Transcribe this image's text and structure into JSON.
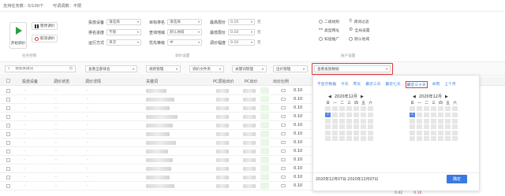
{
  "top_info": {
    "limit": "支持任务数：0/100个",
    "status": "可调调数：不限"
  },
  "task_control": {
    "start_label": "开始调价",
    "pause_label": "暂停调价",
    "cancel_label": "取消调价",
    "group_label": "任务控制"
  },
  "bid_settings": {
    "group_label": "调价设置",
    "fields": [
      {
        "label": "投放设备",
        "value": "请选择"
      },
      {
        "label": "排名进度",
        "value": "不限"
      },
      {
        "label": "运行方式",
        "value": "单次"
      },
      {
        "label": "目标排名",
        "value": "请选择"
      },
      {
        "label": "查询地域",
        "value": "默认地域"
      },
      {
        "label": "优先等级",
        "value": "中"
      },
      {
        "label": "最高限价",
        "value": "0.10"
      },
      {
        "label": "最低限价",
        "value": "0.10"
      },
      {
        "label": "调价幅度",
        "value": "0.10"
      }
    ],
    "unit": "元"
  },
  "account_settings": {
    "group_label": "账户设置",
    "options": [
      {
        "label": "二级规则",
        "icon": "radio-icon"
      },
      {
        "label": "调词过滤",
        "icon": "filter-icon"
      },
      {
        "label": "类型网址",
        "icon": "link-icon"
      },
      {
        "label": "全局设置",
        "icon": "gear-icon"
      },
      {
        "label": "知道推广",
        "icon": "radio-icon"
      },
      {
        "label": "默认地域",
        "icon": "radio-icon"
      }
    ]
  },
  "toolbar": {
    "search_placeholder": "搜索关键词",
    "selects": [
      "查看全部排名",
      "规则管理",
      "调价文件夹",
      "关键词管理",
      "出价管理",
      "查看投放数据"
    ]
  },
  "table": {
    "headers": [
      "投放设备",
      "调价状态",
      "调价详情",
      "关键词",
      "PC原始出价",
      "PC出价",
      "出价比例"
    ],
    "rows": [
      {
        "device": "-",
        "status": "-",
        "detail": "-",
        "ratio": "0.10"
      },
      {
        "device": "-",
        "status": "-",
        "detail": "-",
        "ratio": "0.10"
      },
      {
        "device": "-",
        "status": "-",
        "detail": "-",
        "ratio": "0.10"
      },
      {
        "device": "-",
        "status": "-",
        "detail": "-",
        "ratio": "0.10"
      },
      {
        "device": "-",
        "status": "-",
        "detail": "-",
        "ratio": "0.10"
      },
      {
        "device": "-",
        "status": "-",
        "detail": "-",
        "ratio": "0.10"
      },
      {
        "device": "-",
        "status": "-",
        "detail": "-",
        "ratio": "0.10"
      },
      {
        "device": "-",
        "status": "-",
        "detail": "-",
        "ratio": "0.10"
      },
      {
        "device": "-",
        "status": "-",
        "detail": "-",
        "ratio": "0.10"
      },
      {
        "device": "-",
        "status": "-",
        "detail": "-",
        "ratio": "0.10"
      },
      {
        "device": "-",
        "status": "-",
        "detail": "-",
        "ratio": "0.10"
      },
      {
        "device": "-",
        "status": "-",
        "detail": "-",
        "ratio": "0.10"
      }
    ],
    "tail_values": [
      "0.42",
      "0.10"
    ]
  },
  "date_picker": {
    "quick_ranges": [
      "不显示数据",
      "今天",
      "昨天",
      "最近三天",
      "最近七天",
      "最近三十天",
      "本周",
      "上个月"
    ],
    "selected_quick": "最近三十天",
    "left_month": "2020年12月",
    "right_month": "2020年12月",
    "weekdays": [
      "日",
      "一",
      "二",
      "三",
      "四",
      "五",
      "六"
    ],
    "selected_day": "7",
    "range_text": "2020年12月07日-2020年12月07日",
    "ok_label": "确定"
  },
  "colors": {
    "accent": "#3a79e0",
    "highlight": "#e23a3a",
    "play": "#2e9e3e"
  }
}
